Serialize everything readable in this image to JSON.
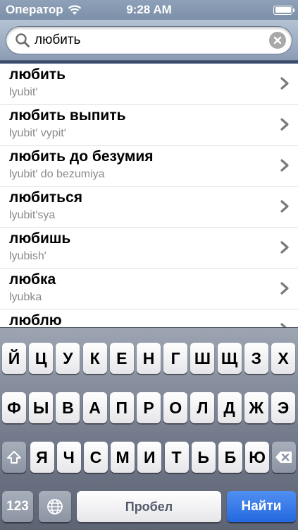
{
  "status_bar": {
    "carrier": "Оператор",
    "time": "9:28 AM",
    "battery_level": 1.0
  },
  "search": {
    "value": "любить",
    "icon": "search-icon",
    "clear_icon": "clear-icon"
  },
  "results": [
    {
      "title": "любить",
      "translit": "lyubit′"
    },
    {
      "title": "любить выпить",
      "translit": "lyubit′ vypit′"
    },
    {
      "title": "любить до безумия",
      "translit": "lyubit′ do bezumiya"
    },
    {
      "title": "любиться",
      "translit": "lyubit′sya"
    },
    {
      "title": "любишь",
      "translit": "lyubish′"
    },
    {
      "title": "любка",
      "translit": "lyubka"
    },
    {
      "title": "люблю",
      "translit": ""
    }
  ],
  "keyboard": {
    "row1": [
      "Й",
      "Ц",
      "У",
      "К",
      "Е",
      "Н",
      "Г",
      "Ш",
      "Щ",
      "З",
      "Х"
    ],
    "row2": [
      "Ф",
      "Ы",
      "В",
      "А",
      "П",
      "Р",
      "О",
      "Л",
      "Д",
      "Ж",
      "Э"
    ],
    "row3": [
      "Я",
      "Ч",
      "С",
      "М",
      "И",
      "Т",
      "Ь",
      "Б",
      "Ю"
    ],
    "numbers_label": "123",
    "space_label": "Пробел",
    "go_label": "Найти",
    "shift_icon": "shift-icon",
    "backspace_icon": "backspace-icon",
    "globe_icon": "globe-icon",
    "go_color": "#2468e0"
  }
}
